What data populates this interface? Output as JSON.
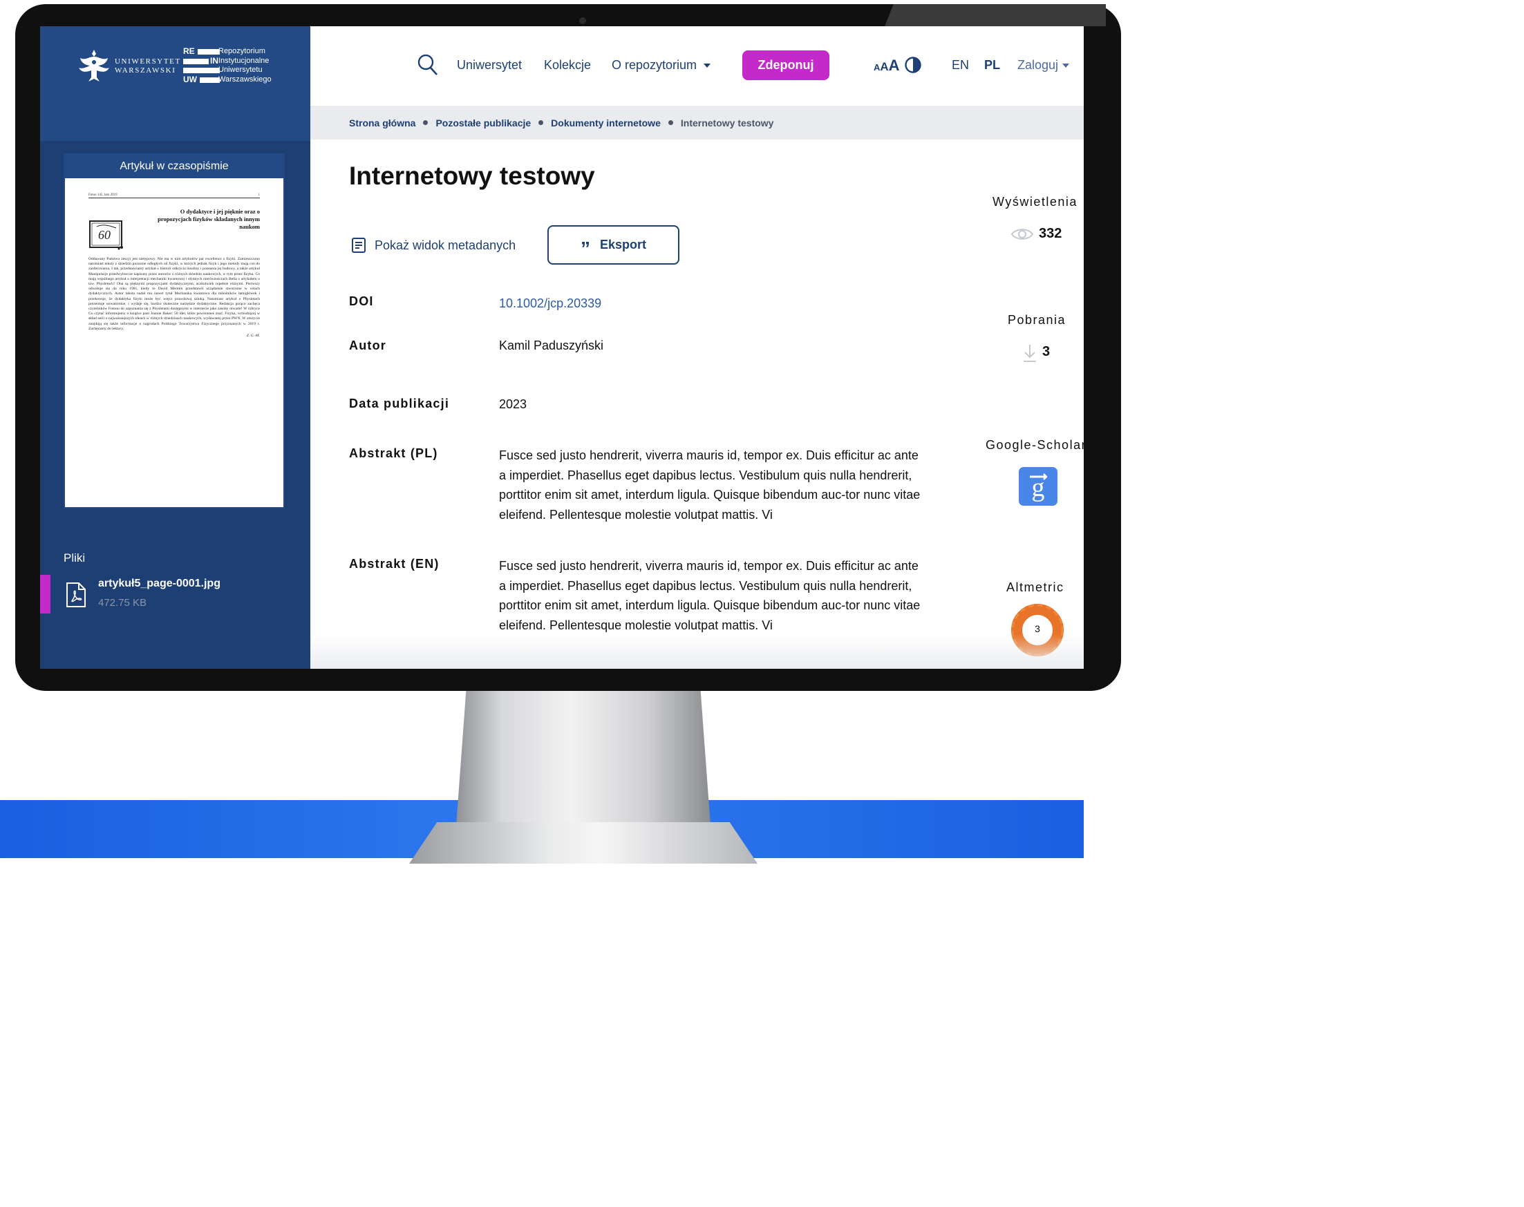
{
  "sidebar": {
    "university_name_line1": "UNIWERSYTET",
    "university_name_line2": "WARSZAWSKI",
    "rein": {
      "tag_re": "RE",
      "tag_in": "IN",
      "tag_uw": "UW",
      "lines": [
        "Repozytorium",
        "Instytucjonalne",
        "Uniwersytetu",
        "Warszawskiego"
      ]
    },
    "doc_type": "Artykuł w czasopiśmie",
    "preview": {
      "header_left": "Foton 145, lato 2019",
      "header_right": "1",
      "title": "O dydaktyce i jej pięknie oraz o propozycjach fizyków składanych innym naukom",
      "body": "Oddawany Państwu zeszyt jest nietypowy. Nie ma w nim artykułów par excellence z fizyki. Zamieszczono natomiast teksty z dziedzin pozornie odległych od fizyki, w których jednak fizyk i jego metody mają coś do zaoferowania. I tak, przedstawiamy artykuł o historii odkrycia insuliny i poznania jej budowy, a także artykuł Manipulacje przedwyborcze napisany przez autorów z różnych dziedzin naukowych, w tym przez fizyka. Co mają wspólnego artykuł o interpretacji mechaniki kwantowej i słynnych nierównościach Bella z artykułem o tzw. Physletach? Oba są pięknymi propozycjami dydaktycznymi, aczkolwiek rupełnie różnymi. Pierwszy odwołuje się do roku 1981, kiedy to David Mermin przedstawił urządzenie stworzone w celach dydaktycznych. Autor tekstu nadał mu nawet tytuł Mechanika kwantowa dla miłośników łamigłówek i przekonuje, że dydaktyka fizyki może być wręcz prawdziwą sztuką. Natomiast artykuł o Physletach prezentuje nowatorskie, i wydaje się, bardzo skuteczne narzędzie dydaktyczne. Redakcja gorąco zachęca czytelników Fotonu do zapoznania się z Physletami dostępnymi w internecie jako zasoby otwarte! W rubryce Co czytać informujemy o książce pani Joanne Baker: 50 idei, które powinieneś znać. Fizyka, wchodzącej w skład serii o najważniejszych ideach w różnych dziedzinach naukowych, wydawanej przez PWN. W zeszycie znajdują się także informacje o nagrodach Polskiego Towarzystwa Fizycznego przyznanych w 2019 r. Zachęcamy do lektury,",
      "signature": "Z. G.-M."
    },
    "files_label": "Pliki",
    "file": {
      "name": "artykuł5_page-0001.jpg",
      "size": "472.75 KB"
    }
  },
  "nav": {
    "links": [
      "Uniwersytet",
      "Kolekcje",
      "O repozytorium"
    ],
    "deposit": "Zdeponuj",
    "font_sizes": [
      "A",
      "A",
      "A"
    ],
    "lang_en": "EN",
    "lang_pl": "PL",
    "login": "Zaloguj"
  },
  "breadcrumb": [
    "Strona główna",
    "Pozostałe publikacje",
    "Dokumenty internetowe",
    "Internetowy testowy"
  ],
  "record": {
    "title": "Internetowy testowy",
    "metadata_toggle": "Pokaż widok metadanych",
    "export": "Eksport",
    "fields": {
      "doi_label": "DOI",
      "doi_value": "10.1002/jcp.20339",
      "author_label": "Autor",
      "author_value": "Kamil Paduszyński",
      "date_label": "Data publikacji",
      "date_value": "2023",
      "abstract_pl_label": "Abstrakt (PL)",
      "abstract_pl_value": "Fusce sed justo hendrerit, viverra mauris id, tempor ex. Duis efficitur ac ante a imperdiet. Phasellus eget dapibus lectus. Vestibulum quis nulla hendrerit, porttitor enim sit amet, interdum ligula. Quisque bibendum auc-tor nunc vitae eleifend. Pellentesque molestie volutpat mattis. Vi",
      "abstract_en_label": "Abstrakt (EN)",
      "abstract_en_value": "Fusce sed justo hendrerit, viverra mauris id, tempor ex. Duis efficitur ac ante a imperdiet. Phasellus eget dapibus lectus. Vestibulum quis nulla hendrerit, porttitor enim sit amet, interdum ligula. Quisque bibendum auc-tor nunc vitae eleifend. Pellentesque molestie volutpat mattis. Vi"
    }
  },
  "stats": {
    "views_label": "Wyświetlenia",
    "views_value": "332",
    "downloads_label": "Pobrania",
    "downloads_value": "3",
    "scholar_label": "Google-Scholar",
    "altmetric_label": "Altmetric",
    "altmetric_value": "3"
  },
  "colors": {
    "brand_navy": "#1d3f73",
    "accent_magenta": "#c32ac9",
    "scholar_blue": "#4a86e8",
    "altmetric_orange": "#e8742a"
  },
  "icons": [
    "search-icon",
    "caret-down-icon",
    "contrast-icon",
    "metadata-list-icon",
    "quote-icon",
    "pdf-file-icon",
    "eye-icon",
    "download-icon",
    "google-scholar-icon",
    "altmetric-donut-icon",
    "university-eagle-logo"
  ]
}
